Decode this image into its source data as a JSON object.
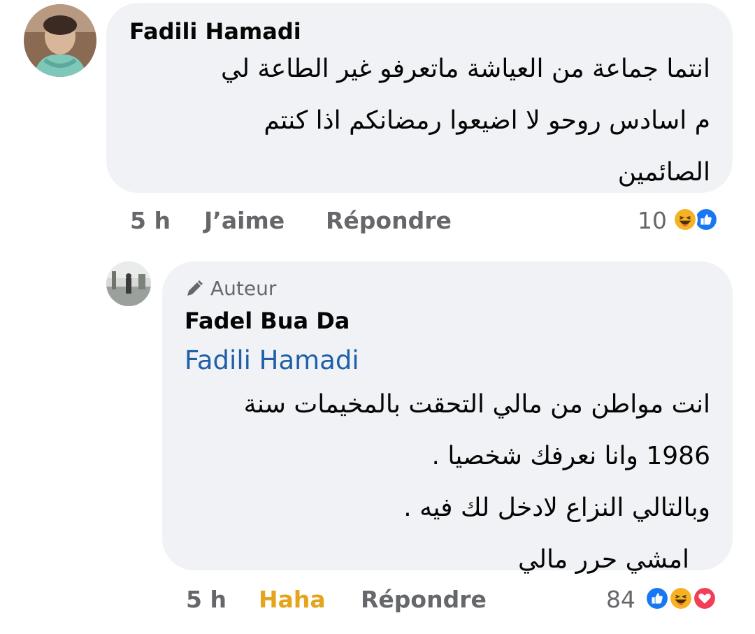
{
  "comment_1": {
    "author": "Fadili Hamadi",
    "lines": [
      "انتما جماعة من العياشة ماتعرفو غير الطاعة لي",
      "م اسادس روحو لا اضيعوا رمضانكم اذا كنتم",
      "الصائمين"
    ],
    "time": "5 h",
    "like_label": "J’aime",
    "reply_label": "Répondre",
    "reaction_count": "10",
    "reactions": [
      "haha-icon",
      "like-icon"
    ]
  },
  "comment_2": {
    "badge": "Auteur",
    "author": "Fadel Bua Da",
    "mention": "Fadili Hamadi",
    "lines": [
      "انت مواطن من مالي التحقت بالمخيمات سنة",
      "1986 وانا نعرفك شخصيا .",
      "وبالتالي النزاع لادخل لك فيه .",
      "امشي حرر مالي"
    ],
    "time": "5 h",
    "reaction_label": "Haha",
    "reply_label": "Répondre",
    "reaction_count": "84",
    "reactions": [
      "like-icon",
      "haha-icon",
      "love-icon"
    ]
  },
  "colors": {
    "bubble": "#f0f2f5",
    "meta": "#65676b",
    "haha_active": "#e4a41c",
    "mention": "#1f5fa8",
    "like_blue": "#1877f2",
    "love_red": "#f33e58"
  }
}
